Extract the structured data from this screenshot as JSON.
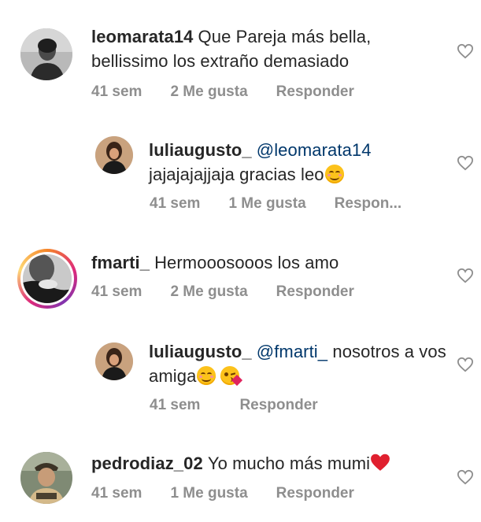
{
  "comments": [
    {
      "username": "leomarata14",
      "text": "Que Pareja más bella, bellissimo los extraño demasiado",
      "time": "41 sem",
      "likes": "2 Me gusta",
      "reply": "Responder"
    },
    {
      "username": "luliaugusto_",
      "mention": "@leomarata14",
      "text": "jajajajajjaja gracias leo",
      "time": "41 sem",
      "likes": "1 Me gusta",
      "reply": "Respon..."
    },
    {
      "username": "fmarti_",
      "text": "Hermooosooos los amo",
      "time": "41 sem",
      "likes": "2 Me gusta",
      "reply": "Responder"
    },
    {
      "username": "luliaugusto_",
      "mention": "@fmarti_",
      "text": "nosotros a vos amiga",
      "time": "41 sem",
      "reply": "Responder"
    },
    {
      "username": "pedrodiaz_02",
      "text": "Yo mucho más mumi",
      "time": "41 sem",
      "likes": "1 Me gusta",
      "reply": "Responder"
    }
  ],
  "colors": {
    "text": "#262626",
    "meta": "#8e8e8e",
    "mention": "#00376b",
    "heart_outline": "#8e8e8e"
  },
  "icons": {
    "like": "heart-outline-icon",
    "emoji_smile": "smiling-face-emoji",
    "emoji_kiss": "face-blowing-kiss-emoji",
    "emoji_heart": "red-heart-emoji"
  }
}
